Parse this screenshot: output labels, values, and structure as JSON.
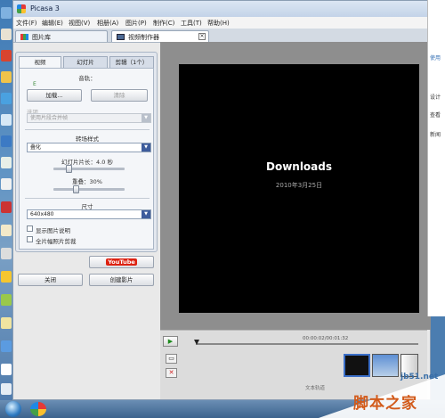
{
  "window": {
    "title": "Picasa 3"
  },
  "menu": [
    "文件(F)",
    "编辑(E)",
    "视图(V)",
    "相册(A)",
    "图片(P)",
    "制作(C)",
    "工具(T)",
    "帮助(H)"
  ],
  "tabs": [
    {
      "label": "图片库"
    },
    {
      "label": "视频制作器"
    }
  ],
  "left_panel": {
    "subtabs": [
      "视频",
      "幻灯片",
      "剪辑（1个）"
    ],
    "audio_label": "音轨：",
    "audio_dot": "E",
    "load_button": "加载...",
    "clear_button": "清除",
    "options_label": "选项",
    "options_value": "使用片段合并帧",
    "transition_label": "转场样式",
    "transition_value": "叠化",
    "slide_duration_label": "幻灯片片长：4.0 秒",
    "overlap_label": "重叠：30%",
    "size_label": "尺寸",
    "size_value": "640x480",
    "show_caption": "显示图片说明",
    "fullframe": "全片幅照片剪裁",
    "youtube_button": "YouTube",
    "close_button": "关闭",
    "create_button": "创建影片"
  },
  "preview": {
    "title": "Downloads",
    "date": "2010年3月25日"
  },
  "timeline": {
    "timecode": "00:00:02/00:01:32",
    "track_label": "文本轨道"
  },
  "right_window": [
    "使用",
    "设计",
    "查看",
    "新闻"
  ],
  "watermark": {
    "site": "jb51.net",
    "text": "脚本之家"
  },
  "colors": {
    "accent": "#3d5c9c",
    "preview_bg": "#000000",
    "watermark": "#d25a1a"
  }
}
